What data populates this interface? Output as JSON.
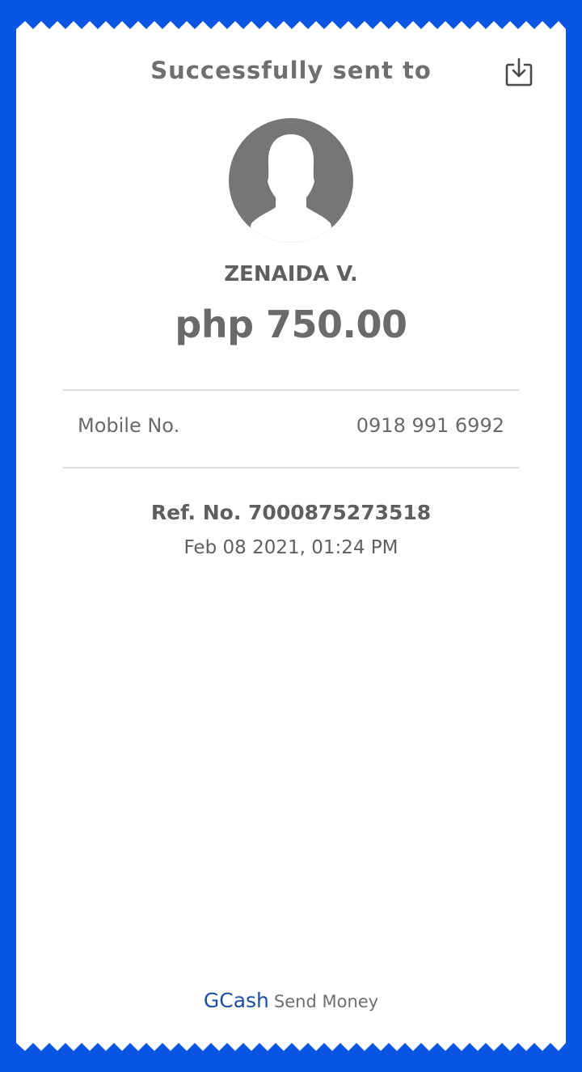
{
  "header": {
    "title": "Successfully sent to",
    "download_icon": "download-icon"
  },
  "recipient": {
    "avatar_icon": "person-avatar-icon",
    "name": "ZENAIDA V.",
    "amount": "php 750.00"
  },
  "details": {
    "mobile_label": "Mobile No.",
    "mobile_value": "0918 991 6992"
  },
  "reference": {
    "ref_no": "Ref. No. 7000875273518",
    "datetime": "Feb 08 2021, 01:24 PM"
  },
  "footer": {
    "brand": "GCash",
    "service": "Send Money"
  },
  "colors": {
    "background": "#0a55e4",
    "receipt": "#ffffff",
    "brand_text": "#1a4ea8",
    "text_gray": "#6a6a6a"
  }
}
